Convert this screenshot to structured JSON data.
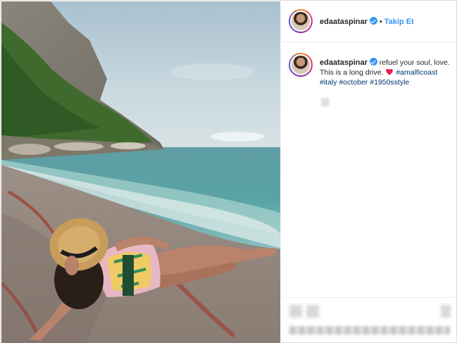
{
  "post": {
    "username": "edaataspinar",
    "follow_label": "Takip Et",
    "separator": "•",
    "caption_text_1": "refuel your soul, love.",
    "caption_text_2": "This is a long drive.",
    "hashtags": [
      "#amalficoast",
      "#italy",
      "#october",
      "#1950sstyle"
    ]
  },
  "colors": {
    "link_blue": "#3897f0",
    "hashtag": "#00376b",
    "heart": "#ed1c4a"
  },
  "icons": {
    "verified": "verified-badge-icon",
    "heart": "red-heart-emoji-icon"
  }
}
